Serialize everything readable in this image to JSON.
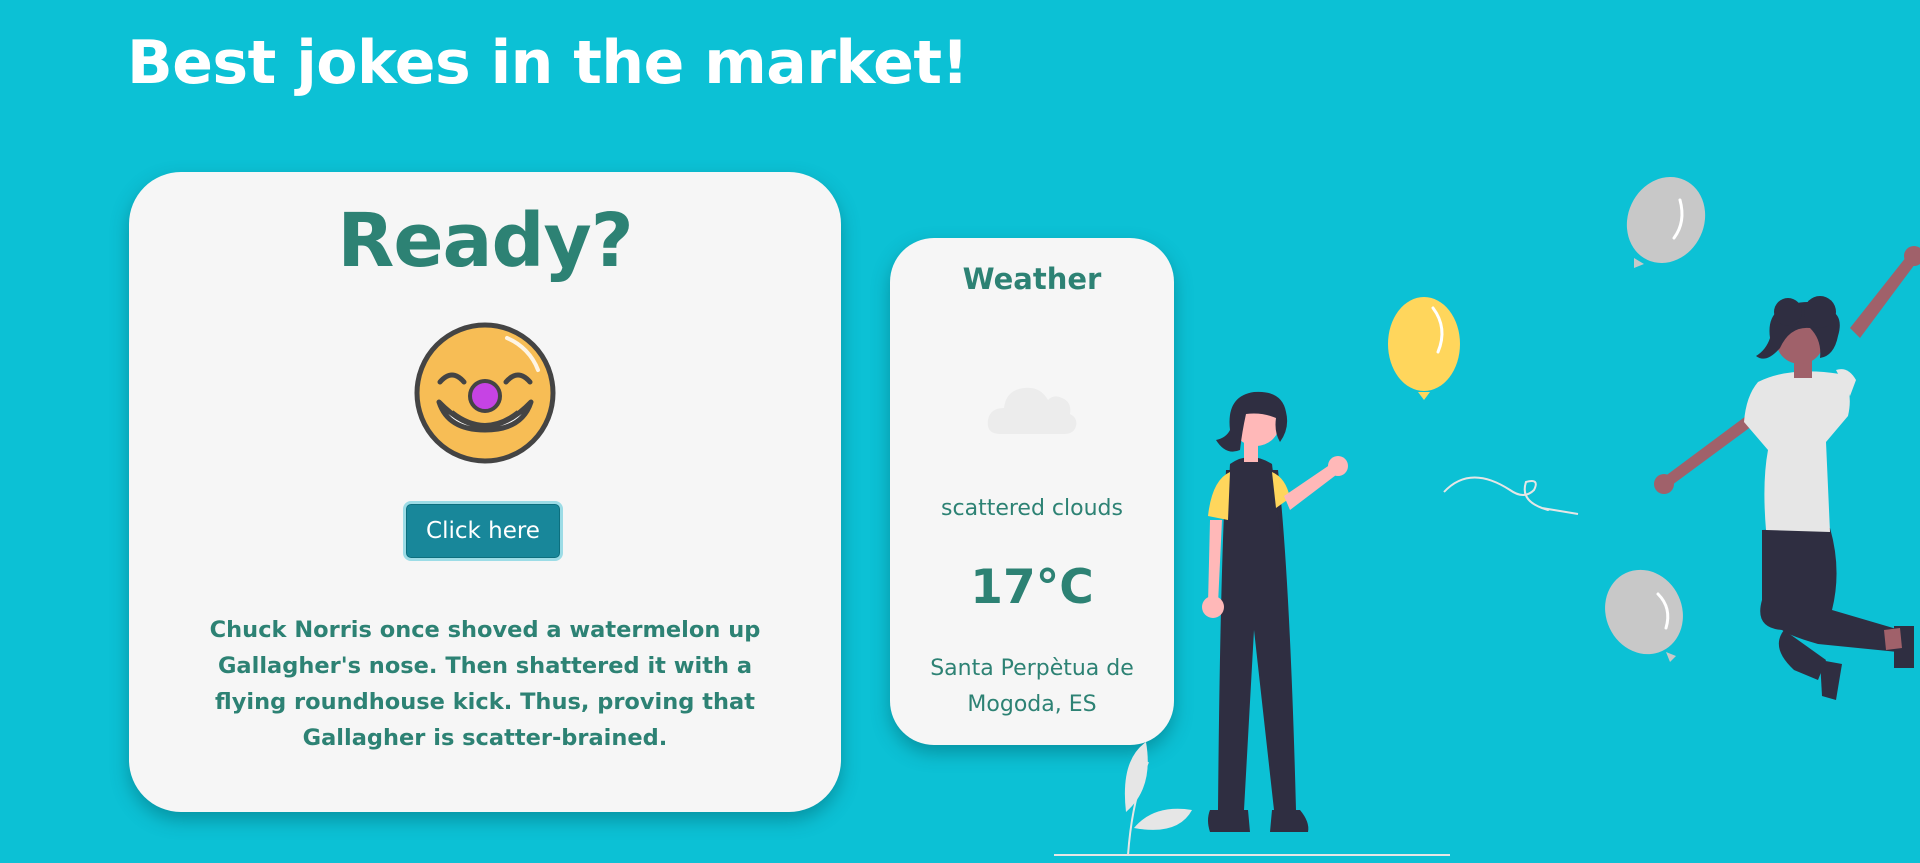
{
  "header": {
    "title": "Best jokes in the market!"
  },
  "joke_card": {
    "heading": "Ready?",
    "emoji_icon": "clown-face-icon",
    "button_label": "Click here",
    "joke_text": "Chuck Norris once shoved a watermelon up Gallagher's nose. Then shattered it with a flying roundhouse kick. Thus, proving that Gallagher is scatter-brained."
  },
  "weather": {
    "title": "Weather",
    "icon": "cloud-icon",
    "description": "scattered clouds",
    "temperature": "17°C",
    "location": "Santa Perpètua de Mogoda, ES"
  },
  "colors": {
    "background": "#0cc1d5",
    "card": "#f6f6f6",
    "accent_text": "#2d8274",
    "button": "#18879a",
    "balloon_yellow": "#ffd65c",
    "balloon_gray": "#c8c8c8"
  }
}
